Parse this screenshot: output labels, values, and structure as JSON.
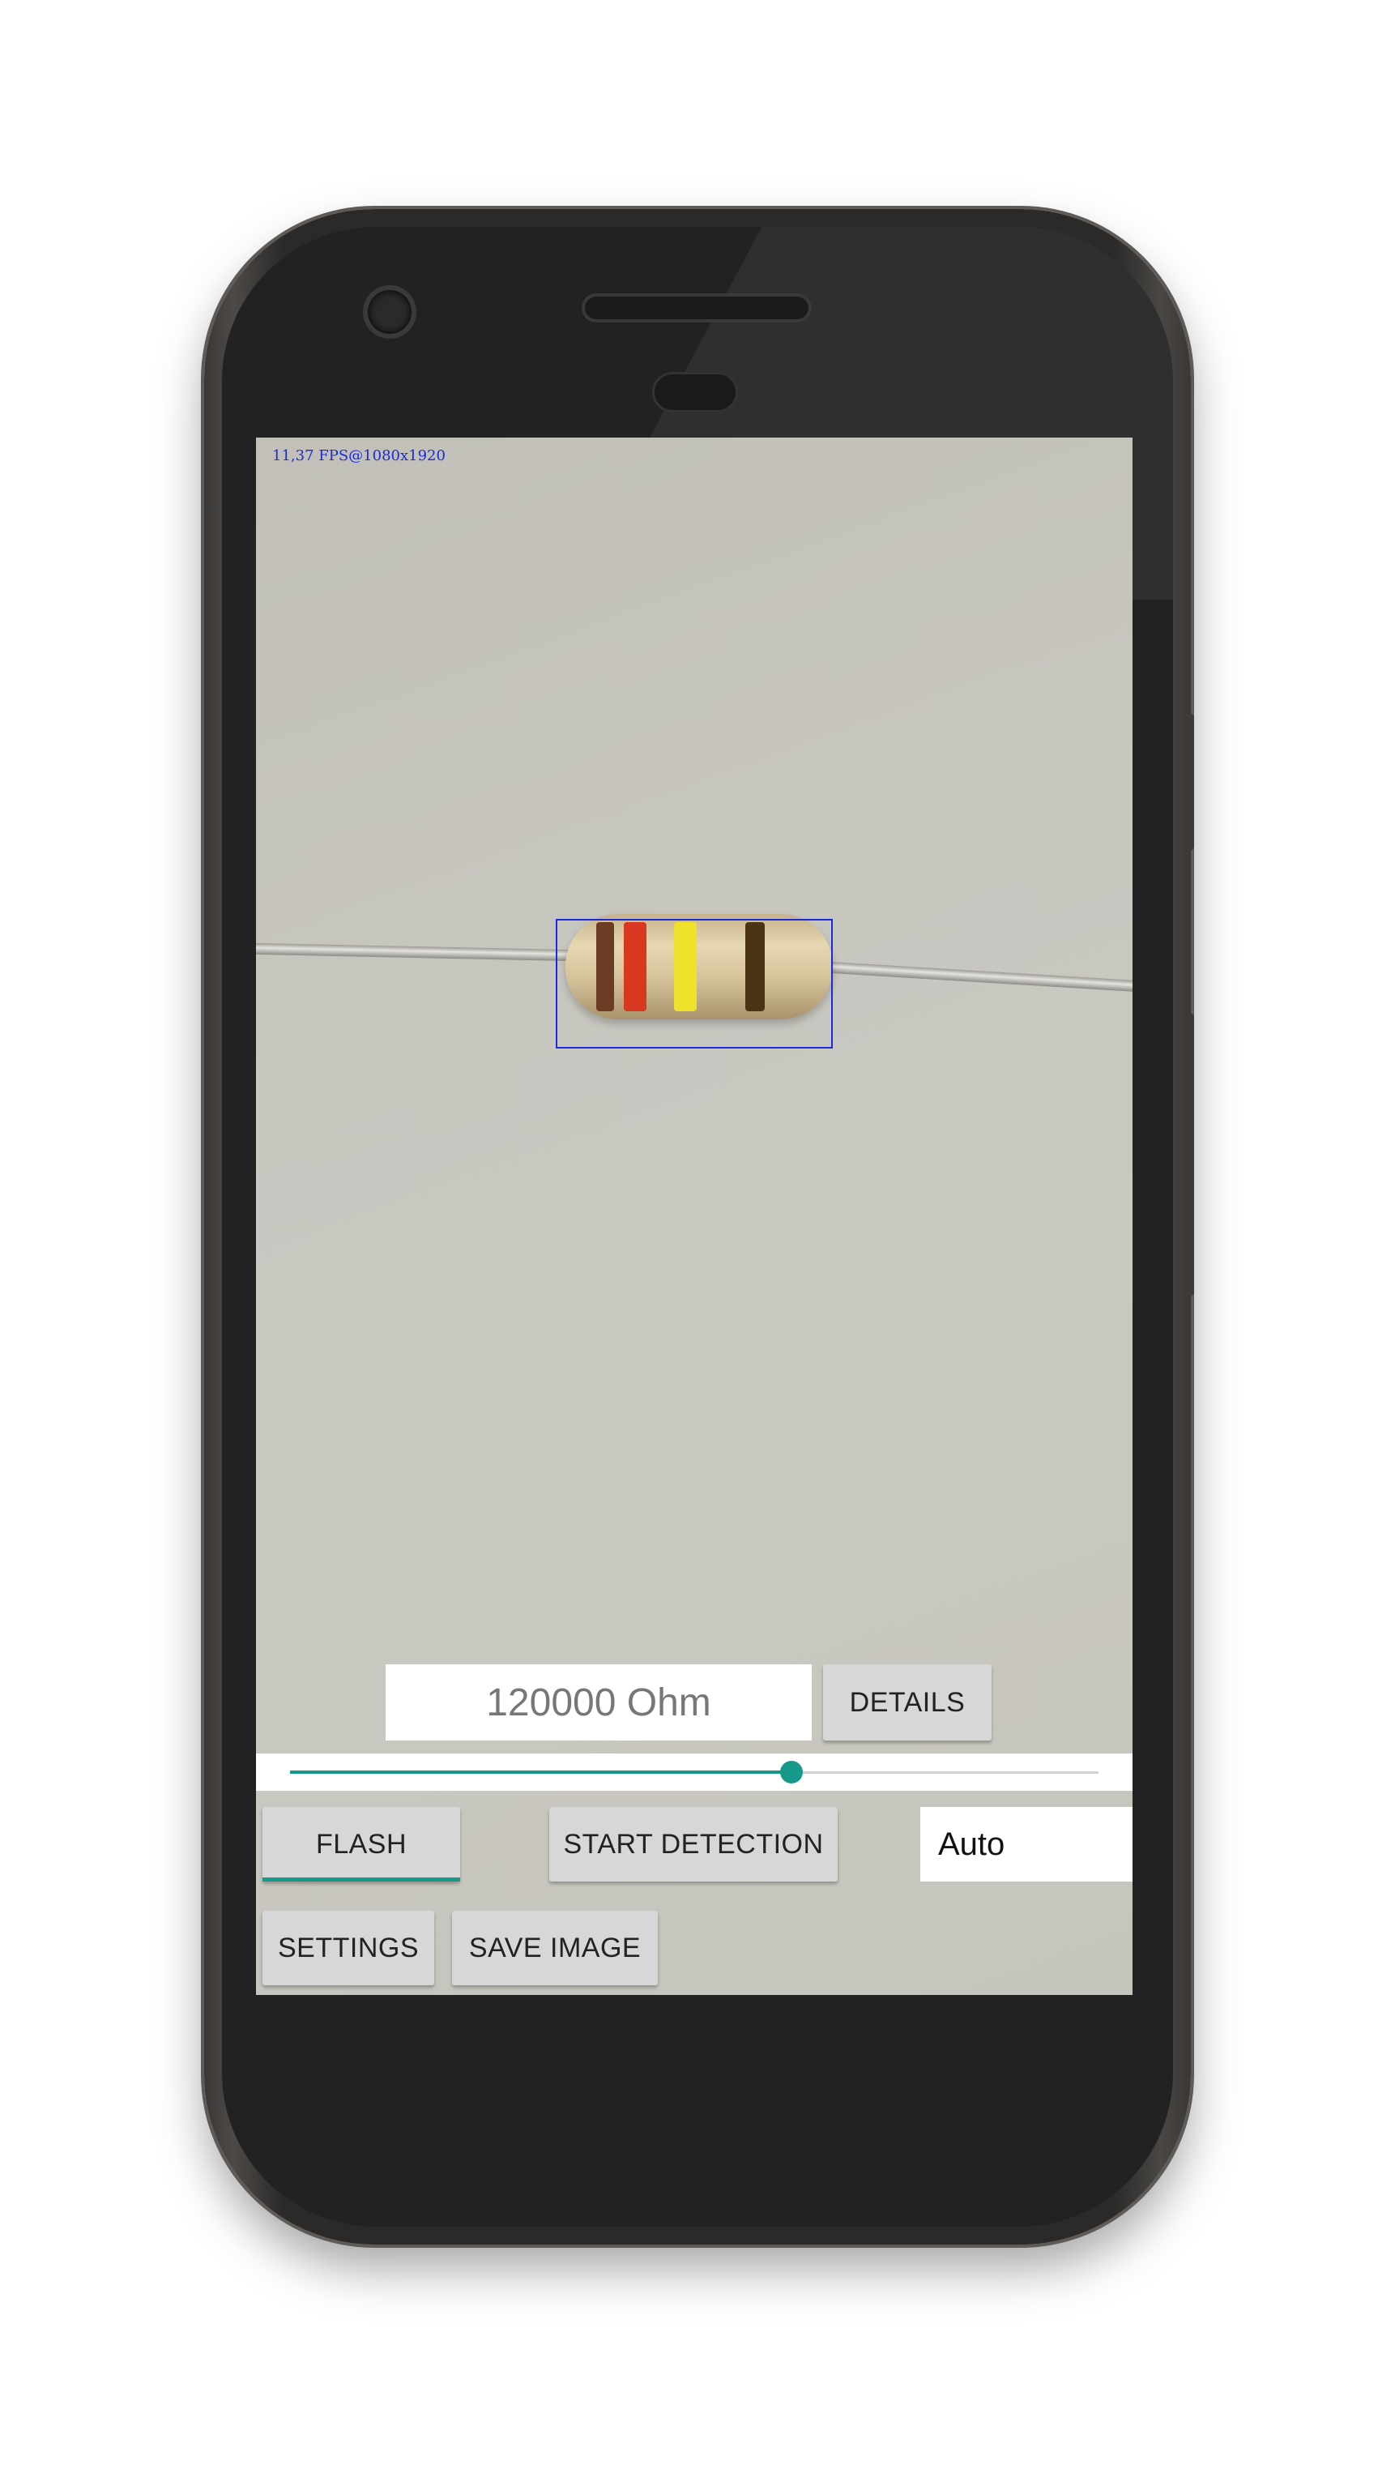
{
  "overlay": {
    "fps_text": "11,37 FPS@1080x1920"
  },
  "resistor": {
    "bands": [
      "#6b3b23",
      "#d7381f",
      "#f0e12a",
      "#4a3414"
    ],
    "detection_box_color": "#1a2bd9"
  },
  "result": {
    "value": "120000 Ohm"
  },
  "buttons": {
    "details": "DETAILS",
    "flash": "FLASH",
    "start_detection": "START DETECTION",
    "settings": "SETTINGS",
    "save_image": "SAVE IMAGE"
  },
  "slider": {
    "value_fraction": 0.62,
    "accent_color": "#17998a"
  },
  "mode_select": {
    "selected": "Auto"
  }
}
